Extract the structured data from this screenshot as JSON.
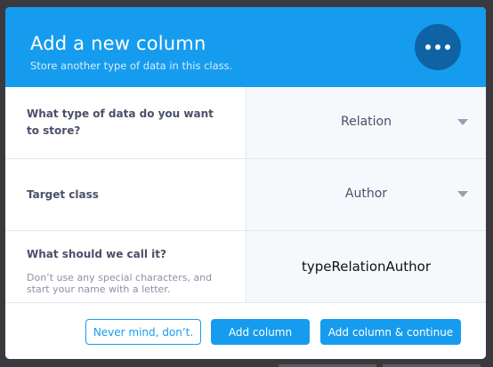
{
  "dialog": {
    "title": "Add a new column",
    "subtitle": "Store another type of data in this class.",
    "more_icon": "ellipsis-icon"
  },
  "fields": [
    {
      "label": "What type of data do you want to store?",
      "value": "Relation",
      "control": "dropdown"
    },
    {
      "label": "Target class",
      "value": "Author",
      "control": "dropdown"
    },
    {
      "label": "What should we call it?",
      "description": "Don’t use any special characters, and start your name with a letter.",
      "value": "typeRelationAuthor",
      "control": "text-input"
    }
  ],
  "footer": {
    "cancel_label": "Never mind, don’t.",
    "add_label": "Add column",
    "add_continue_label": "Add column & continue"
  },
  "colors": {
    "accent": "#169cee",
    "more_button": "#0f62a4",
    "label_text": "#4b4f6b",
    "value_cell_bg": "#f6f9fc"
  }
}
